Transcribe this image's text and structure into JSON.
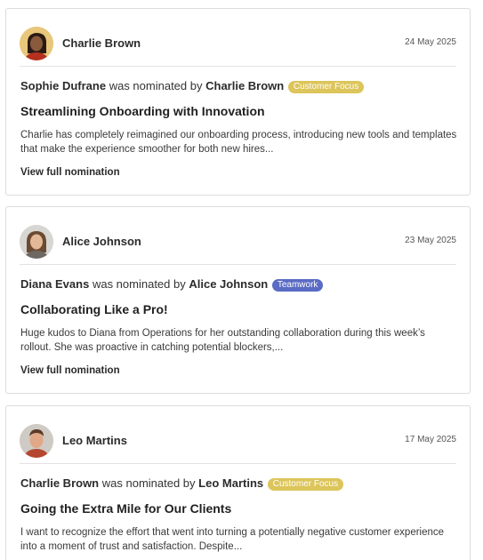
{
  "nominations": [
    {
      "author": "Charlie Brown",
      "avatar_icon": "woman-avatar-icon",
      "date": "24 May 2025",
      "nominee": "Sophie Dufrane",
      "verb": "was nominated by",
      "nominator": "Charlie Brown",
      "category": "Customer Focus",
      "category_color": "#dcc55a",
      "title": "Streamlining Onboarding with Innovation",
      "excerpt": "Charlie has completely reimagined our onboarding process, introducing new tools and templates that make the experience smoother for both new hires...",
      "link": "View full nomination"
    },
    {
      "author": "Alice Johnson",
      "avatar_icon": "woman-avatar-icon",
      "date": "23 May 2025",
      "nominee": "Diana Evans",
      "verb": "was nominated by",
      "nominator": "Alice Johnson",
      "category": "Teamwork",
      "category_color": "#5a6bc4",
      "title": "Collaborating Like a Pro!",
      "excerpt": "Huge kudos to Diana from Operations for her outstanding collaboration during this week’s rollout. She was proactive in catching potential blockers,...",
      "link": "View full nomination"
    },
    {
      "author": "Leo Martins",
      "avatar_icon": "man-avatar-icon",
      "date": "17 May 2025",
      "nominee": "Charlie Brown",
      "verb": "was nominated by",
      "nominator": "Leo Martins",
      "category": "Customer Focus",
      "category_color": "#dcc55a",
      "title": "Going the Extra Mile for Our Clients",
      "excerpt": "I want to recognize the effort that went into turning a potentially negative customer experience into a moment of trust and satisfaction. Despite...",
      "link": ""
    }
  ]
}
